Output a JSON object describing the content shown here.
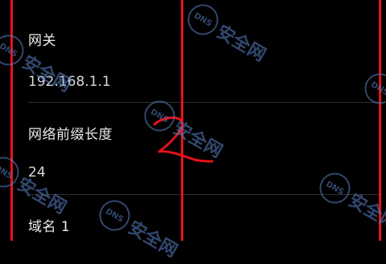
{
  "network": {
    "gateway": {
      "label": "网关",
      "value": "192.168.1.1"
    },
    "prefix_length": {
      "label": "网络前缀长度",
      "value": "24"
    },
    "domain1": {
      "label": "域名 1"
    }
  },
  "annotation": {
    "mark_color": "#e8111a"
  },
  "watermark": {
    "logo_text": "DNS",
    "text": "安全网",
    "color": "#5c82c8"
  }
}
